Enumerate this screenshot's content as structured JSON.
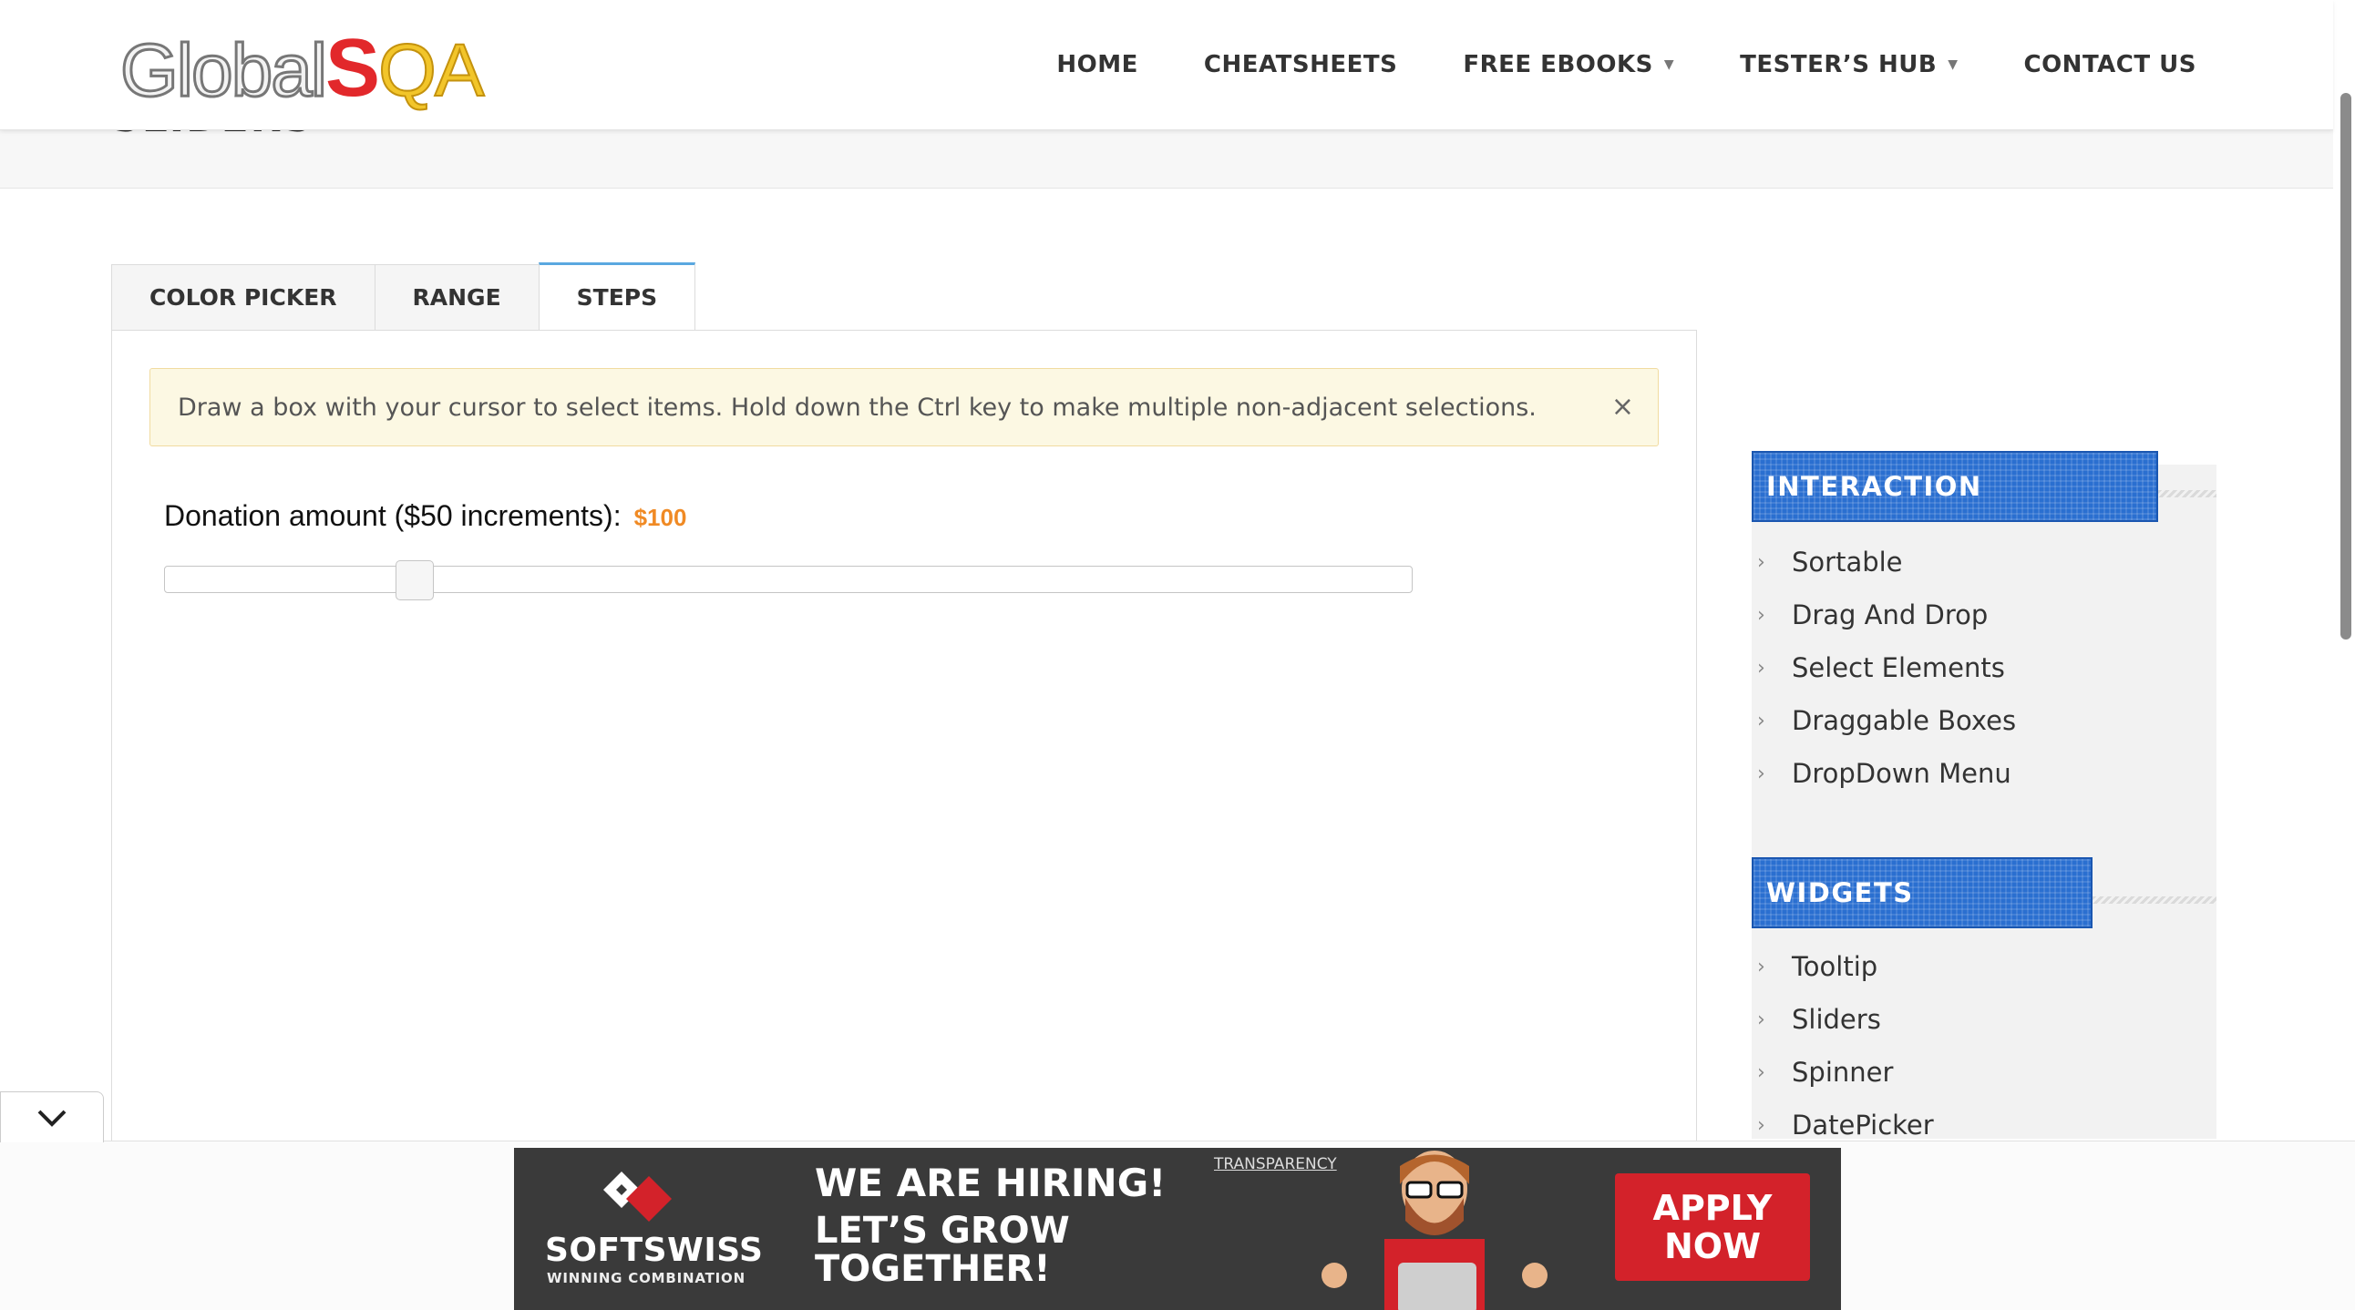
{
  "header": {
    "logo_text_part1": "Global",
    "logo_text_part2": "S",
    "logo_text_part3": "QA",
    "nav": [
      {
        "label": "HOME",
        "has_dropdown": false
      },
      {
        "label": "CHEATSHEETS",
        "has_dropdown": false
      },
      {
        "label": "FREE EBOOKS",
        "has_dropdown": true
      },
      {
        "label": "TESTER’S HUB",
        "has_dropdown": true
      },
      {
        "label": "CONTACT US",
        "has_dropdown": false
      }
    ]
  },
  "page": {
    "title": "SLIDERS"
  },
  "tabs": [
    {
      "label": "COLOR PICKER",
      "active": false
    },
    {
      "label": "RANGE",
      "active": false
    },
    {
      "label": "STEPS",
      "active": true
    }
  ],
  "alert": {
    "text": "Draw a box with your cursor to select items. Hold down the Ctrl key to make multiple non-adjacent selections.",
    "close_symbol": "×"
  },
  "slider": {
    "label": "Donation amount ($50 increments):",
    "value_text": "$100",
    "position_fraction": 0.2
  },
  "sidebar": {
    "sections": [
      {
        "heading": "INTERACTION",
        "items": [
          "Sortable",
          "Drag And Drop",
          "Select Elements",
          "Draggable Boxes",
          "DropDown Menu"
        ]
      },
      {
        "heading": "WIDGETS",
        "items": [
          "Tooltip",
          "Sliders",
          "Spinner",
          "DatePicker"
        ]
      }
    ]
  },
  "ad": {
    "brand": "SOFTSWISS",
    "brand_sub": "WINNING COMBINATION",
    "headline": "WE ARE HIRING!",
    "subheadline": "LET’S GROW TOGETHER!",
    "annotation": "TRANSPARENCY",
    "cta": "APPLY NOW"
  },
  "colors": {
    "accent_blue": "#2a6fd0",
    "alert_bg": "#fcf8e3",
    "amount_orange": "#f08a24",
    "cta_red": "#d3222a"
  },
  "icons": {
    "collapse": "chevron-down-icon",
    "alert_close": "close-icon",
    "sidebar_bullet": "chevron-right-icon",
    "nav_dropdown": "caret-down-icon"
  }
}
